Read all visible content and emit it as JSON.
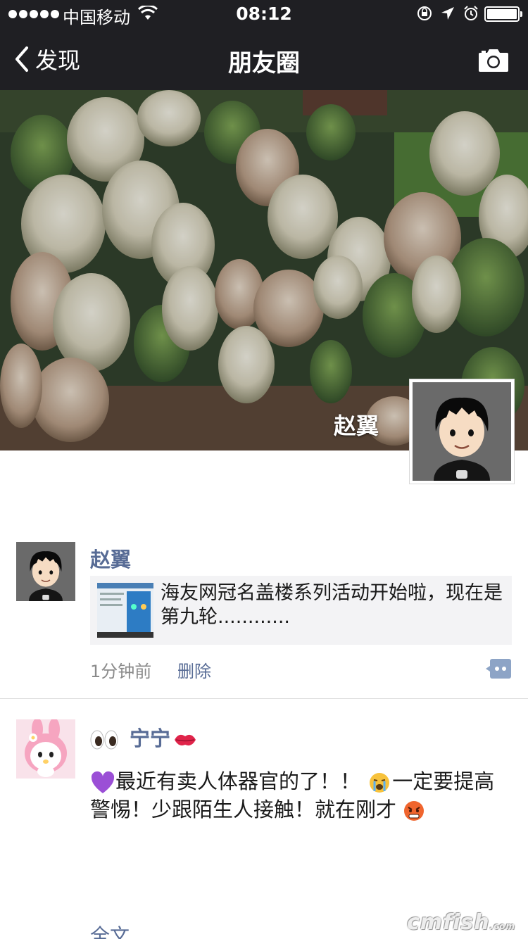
{
  "status_bar": {
    "carrier": "中国移动",
    "time": "08:12"
  },
  "nav": {
    "back_label": "发现",
    "title": "朋友圈"
  },
  "cover": {
    "user_name": "赵翼"
  },
  "posts": [
    {
      "user": "赵翼",
      "link_text": "海友网冠名盖楼系列活动开始啦，现在是第九轮............",
      "time": "1分钟前",
      "delete_label": "删除"
    },
    {
      "user": "宁宁",
      "text_a": "最近有卖人体器官的了！！",
      "text_b": "一定要提高警惕！少跟陌生人接触！就在刚才",
      "full_text_label": "全文"
    }
  ],
  "watermark": {
    "text": "cmfish",
    "small": ".com"
  },
  "colors": {
    "nav_bg": "#1f1f23",
    "link_blue": "#576b95",
    "card_bg": "#f3f3f5"
  }
}
